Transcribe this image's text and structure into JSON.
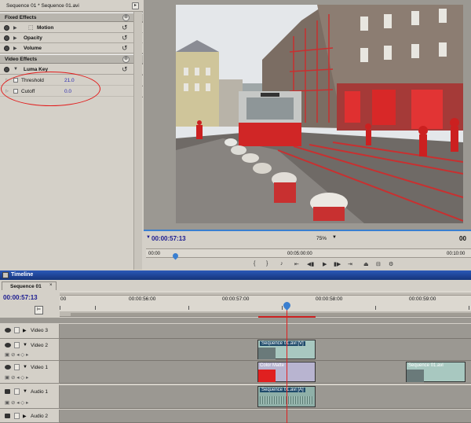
{
  "effect_controls": {
    "breadcrumb": "Sequence 01 * Sequence 01.avi",
    "fixed_effects_header": "Fixed Effects",
    "fixed_effects": [
      {
        "label": "Motion"
      },
      {
        "label": "Opacity"
      },
      {
        "label": "Volume"
      }
    ],
    "video_effects_header": "Video Effects",
    "luma_key": {
      "label": "Luma Key",
      "params": [
        {
          "label": "Threshold",
          "value": "21.0"
        },
        {
          "label": "Cutoff",
          "value": "0.0"
        }
      ]
    }
  },
  "monitor": {
    "timecode": "00:00:57:13",
    "zoom": "75%",
    "timecode_right": "00",
    "ruler": {
      "left": "00:00",
      "mid": "00:05:00:00",
      "right": "00:10:00"
    }
  },
  "timeline": {
    "title": "Timeline",
    "tab": "Sequence 01",
    "timecode": "00:00:57:13",
    "ruler": {
      "t0": "00",
      "t1": "00:00:56:00",
      "t2": "00:00:57:00",
      "t3": "00:00:58:00",
      "t4": "00:00:59:00"
    },
    "tracks": [
      {
        "label": "Video 3"
      },
      {
        "label": "Video 2"
      },
      {
        "label": "Video 1"
      },
      {
        "label": "Audio 1"
      },
      {
        "label": "Audio 2"
      }
    ],
    "clips": {
      "v2": "Sequence 01.avi [V]",
      "v1_matte": "Color Matte",
      "v1_right": "Sequence 01.avi",
      "a1": "Sequence 01.avi [A]"
    }
  },
  "colors": {
    "annotation": "#e21b1b",
    "timecode_blue": "#1a1a90",
    "playhead": "#e02020",
    "title_bar": "#1c3a80"
  }
}
